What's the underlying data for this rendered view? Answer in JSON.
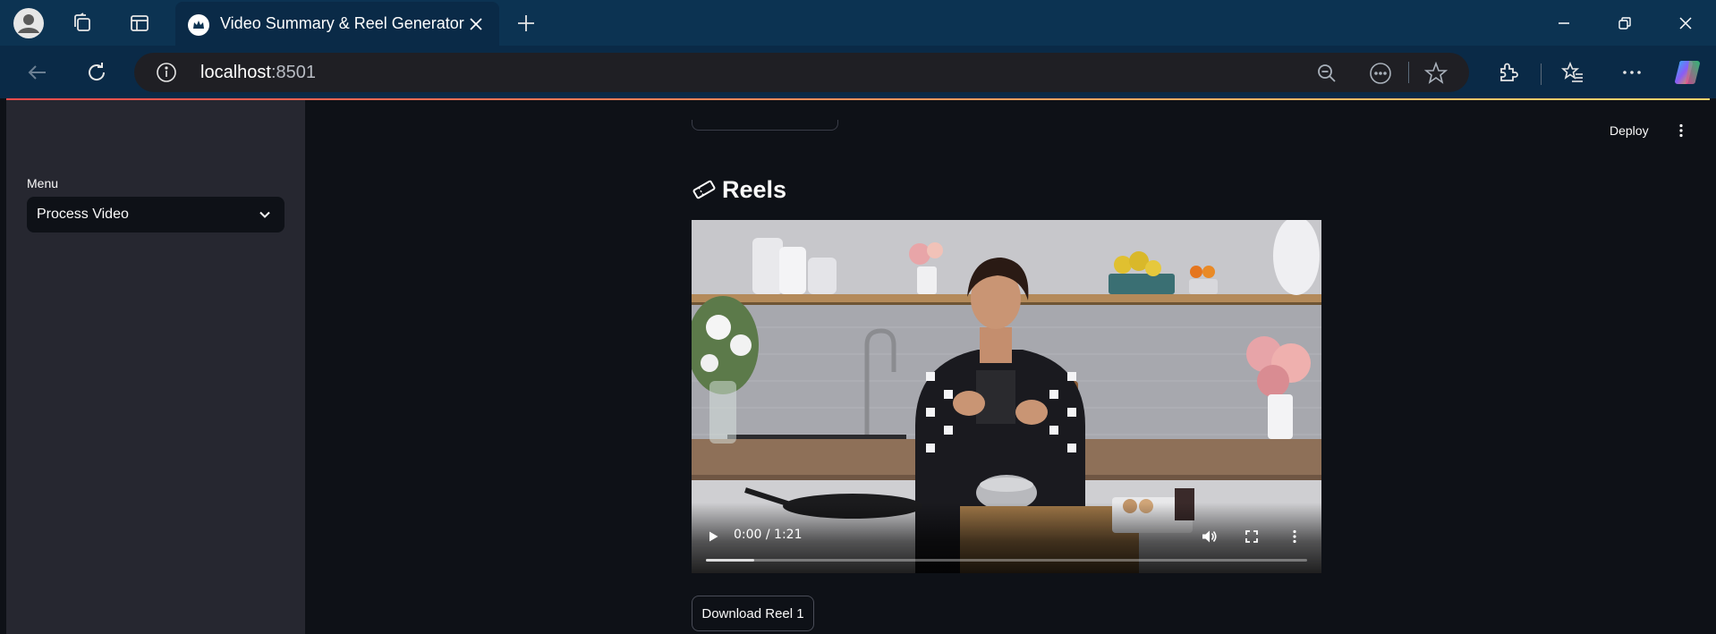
{
  "browser": {
    "tab": {
      "title": "Video Summary & Reel Generator"
    },
    "url": {
      "host": "localhost",
      "port": ":8501"
    },
    "icons": {
      "profile": "profile-icon",
      "workspaces": "workspaces-icon",
      "tab_actions": "tab-actions-icon",
      "new_tab": "plus-icon",
      "back": "back-arrow-icon",
      "refresh": "refresh-icon",
      "site_info": "info-icon",
      "zoom": "zoom-out-icon",
      "reader": "more-options-icon",
      "favorite": "star-icon",
      "extensions": "extensions-icon",
      "favorites": "favorites-icon",
      "settings": "ellipsis-icon",
      "copilot": "copilot-icon",
      "minimize": "minimize-icon",
      "restore": "restore-icon",
      "close": "close-icon"
    }
  },
  "app": {
    "header": {
      "deploy_label": "Deploy"
    },
    "sidebar": {
      "menu_label": "Menu",
      "select_value": "Process Video"
    },
    "main": {
      "heading": "Reels",
      "heading_icon": "film-ticket-icon",
      "video": {
        "time": "0:00 / 1:21",
        "progress_fraction": 0,
        "buffered_fraction": 0.08
      },
      "download_button": "Download Reel 1"
    },
    "colors": {
      "accent_gradient_start": "#ff4b4b",
      "accent_gradient_end": "#ffd16a",
      "sidebar_bg": "#262730",
      "app_bg": "#0e1117",
      "chrome_bg": "#0c3352"
    }
  }
}
